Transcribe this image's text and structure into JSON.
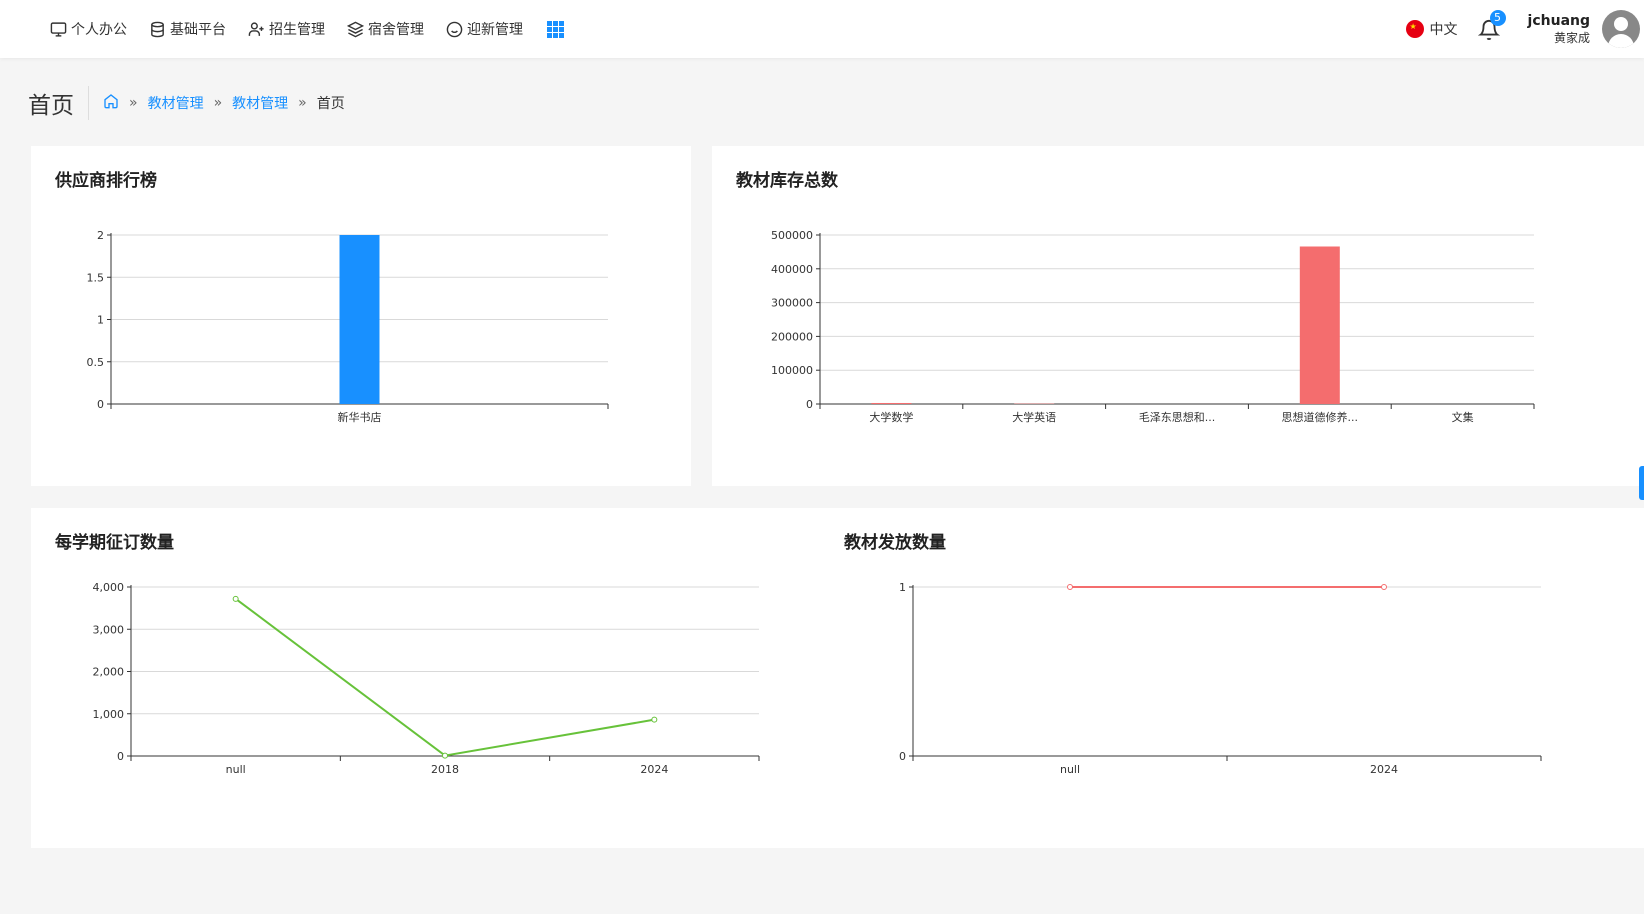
{
  "nav": {
    "items": [
      {
        "label": "个人办公",
        "icon": "monitor-icon"
      },
      {
        "label": "基础平台",
        "icon": "database-icon"
      },
      {
        "label": "招生管理",
        "icon": "user-add-icon"
      },
      {
        "label": "宿舍管理",
        "icon": "layers-icon"
      },
      {
        "label": "迎新管理",
        "icon": "smile-icon"
      }
    ]
  },
  "header": {
    "language": "中文",
    "notification_count": "5",
    "username": "jchuang",
    "realname": "黄家成"
  },
  "page": {
    "title": "首页",
    "breadcrumb": [
      "教材管理",
      "教材管理",
      "首页"
    ]
  },
  "chart_data": [
    {
      "id": "supplier",
      "type": "bar",
      "title": "供应商排行榜",
      "categories": [
        "新华书店"
      ],
      "values": [
        2
      ],
      "ylim": [
        0,
        2
      ],
      "yticks": [
        "0",
        "0.5",
        "1",
        "1.5",
        "2"
      ],
      "color": "#1890ff"
    },
    {
      "id": "inventory",
      "type": "bar",
      "title": "教材库存总数",
      "categories": [
        "大学数学",
        "大学英语",
        "毛泽东思想和...",
        "思想道德修养...",
        "文集"
      ],
      "values": [
        3000,
        1000,
        0,
        466000,
        0
      ],
      "ylim": [
        0,
        500000
      ],
      "yticks": [
        "0",
        "100000",
        "200000",
        "300000",
        "400000",
        "500000"
      ],
      "color": "#f46d6e"
    },
    {
      "id": "order",
      "type": "line",
      "title": "每学期征订数量",
      "categories": [
        "null",
        "2018",
        "2024"
      ],
      "values": [
        3720,
        10,
        860
      ],
      "ylim": [
        0,
        4000
      ],
      "yticks": [
        "0",
        "1,000",
        "2,000",
        "3,000",
        "4,000"
      ],
      "color": "#67c23a"
    },
    {
      "id": "issue",
      "type": "line",
      "title": "教材发放数量",
      "categories": [
        "null",
        "2024"
      ],
      "values": [
        1,
        1
      ],
      "ylim": [
        0,
        1
      ],
      "yticks": [
        "0",
        "1"
      ],
      "color": "#f46d6e"
    }
  ]
}
